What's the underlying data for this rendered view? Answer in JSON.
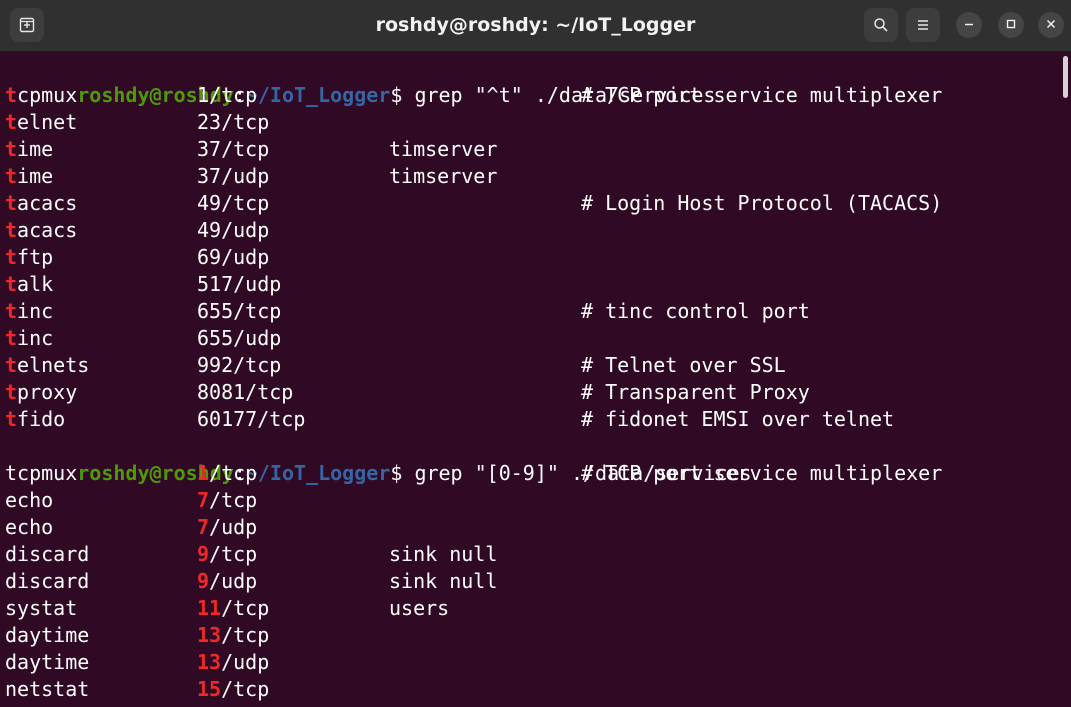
{
  "window": {
    "title": "roshdy@roshdy: ~/IoT_Logger",
    "colors": {
      "background": "#300a24",
      "prompt_user": "#4e9a06",
      "prompt_path": "#3465a4",
      "match": "#ef2929",
      "text": "#ffffff"
    },
    "icons": {
      "new_tab": "new-tab-icon",
      "search": "search-icon",
      "menu": "hamburger-menu-icon",
      "minimize": "minimize-icon",
      "maximize": "maximize-icon",
      "close": "close-icon"
    }
  },
  "terminal": {
    "prompts": [
      {
        "user": "roshdy@roshdy",
        "sep": ":",
        "path": "~/IoT_Logger",
        "symbol": "$ ",
        "command": "grep \"^t\" ./data/services"
      },
      {
        "user": "roshdy@roshdy",
        "sep": ":",
        "path": "~/IoT_Logger",
        "symbol": "$ ",
        "command": "grep \"[0-9]\" ./data/services"
      }
    ],
    "output1": [
      {
        "name_match": "t",
        "name_rest": "cpmux",
        "port": "1/tcp",
        "aliases": "",
        "comment": "# TCP port service multiplexer"
      },
      {
        "name_match": "t",
        "name_rest": "elnet",
        "port": "23/tcp",
        "aliases": "",
        "comment": ""
      },
      {
        "name_match": "t",
        "name_rest": "ime",
        "port": "37/tcp",
        "aliases": "timserver",
        "comment": ""
      },
      {
        "name_match": "t",
        "name_rest": "ime",
        "port": "37/udp",
        "aliases": "timserver",
        "comment": ""
      },
      {
        "name_match": "t",
        "name_rest": "acacs",
        "port": "49/tcp",
        "aliases": "",
        "comment": "# Login Host Protocol (TACACS)"
      },
      {
        "name_match": "t",
        "name_rest": "acacs",
        "port": "49/udp",
        "aliases": "",
        "comment": ""
      },
      {
        "name_match": "t",
        "name_rest": "ftp",
        "port": "69/udp",
        "aliases": "",
        "comment": ""
      },
      {
        "name_match": "t",
        "name_rest": "alk",
        "port": "517/udp",
        "aliases": "",
        "comment": ""
      },
      {
        "name_match": "t",
        "name_rest": "inc",
        "port": "655/tcp",
        "aliases": "",
        "comment": "# tinc control port"
      },
      {
        "name_match": "t",
        "name_rest": "inc",
        "port": "655/udp",
        "aliases": "",
        "comment": ""
      },
      {
        "name_match": "t",
        "name_rest": "elnets",
        "port": "992/tcp",
        "aliases": "",
        "comment": "# Telnet over SSL"
      },
      {
        "name_match": "t",
        "name_rest": "proxy",
        "port": "8081/tcp",
        "aliases": "",
        "comment": "# Transparent Proxy"
      },
      {
        "name_match": "t",
        "name_rest": "fido",
        "port": "60177/tcp",
        "aliases": "",
        "comment": "# fidonet EMSI over telnet"
      }
    ],
    "output2": [
      {
        "name": "tcpmux",
        "port_match": "1",
        "port_rest": "/tcp",
        "aliases": "",
        "comment": "# TCP port service multiplexer"
      },
      {
        "name": "echo",
        "port_match": "7",
        "port_rest": "/tcp",
        "aliases": "",
        "comment": ""
      },
      {
        "name": "echo",
        "port_match": "7",
        "port_rest": "/udp",
        "aliases": "",
        "comment": ""
      },
      {
        "name": "discard",
        "port_match": "9",
        "port_rest": "/tcp",
        "aliases": "sink null",
        "comment": ""
      },
      {
        "name": "discard",
        "port_match": "9",
        "port_rest": "/udp",
        "aliases": "sink null",
        "comment": ""
      },
      {
        "name": "systat",
        "port_match": "11",
        "port_rest": "/tcp",
        "aliases": "users",
        "comment": ""
      },
      {
        "name": "daytime",
        "port_match": "13",
        "port_rest": "/tcp",
        "aliases": "",
        "comment": ""
      },
      {
        "name": "daytime",
        "port_match": "13",
        "port_rest": "/udp",
        "aliases": "",
        "comment": ""
      },
      {
        "name": "netstat",
        "port_match": "15",
        "port_rest": "/tcp",
        "aliases": "",
        "comment": ""
      }
    ]
  }
}
